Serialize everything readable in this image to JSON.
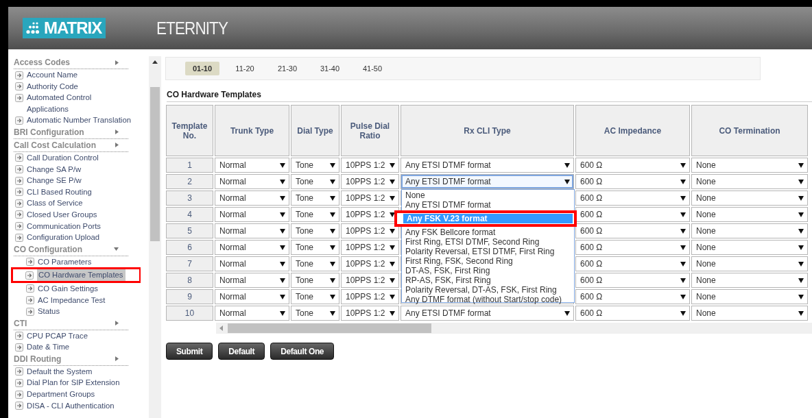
{
  "header": {
    "logo": "MATRIX",
    "product": "ETERNITY"
  },
  "sidebar": {
    "items": [
      {
        "kind": "group",
        "label": "Access Codes",
        "expanded": false
      },
      {
        "kind": "link",
        "label": "Account Name",
        "selected": false
      },
      {
        "kind": "link",
        "label": "Authority Code",
        "selected": false
      },
      {
        "kind": "link",
        "label": "Automated Control Applications",
        "selected": false
      },
      {
        "kind": "link",
        "label": "Automatic Number Translation",
        "selected": false
      },
      {
        "kind": "group",
        "label": "BRI Configuration",
        "expanded": false
      },
      {
        "kind": "group",
        "label": "Call Cost Calculation",
        "expanded": false
      },
      {
        "kind": "link",
        "label": "Call Duration Control",
        "selected": false
      },
      {
        "kind": "link",
        "label": "Change SA P/w",
        "selected": false
      },
      {
        "kind": "link",
        "label": "Change SE P/w",
        "selected": false
      },
      {
        "kind": "link",
        "label": "CLI Based Routing",
        "selected": false
      },
      {
        "kind": "link",
        "label": "Class of Service",
        "selected": false
      },
      {
        "kind": "link",
        "label": "Closed User Groups",
        "selected": false
      },
      {
        "kind": "link",
        "label": "Communication Ports",
        "selected": false
      },
      {
        "kind": "link",
        "label": "Configuration Upload",
        "selected": false
      },
      {
        "kind": "group",
        "label": "CO Configuration",
        "expanded": true,
        "children": [
          {
            "label": "CO Parameters",
            "selected": false,
            "highlighted": false
          },
          {
            "label": "CO Hardware Templates",
            "selected": true,
            "highlighted": true
          },
          {
            "label": "CO Gain Settings",
            "selected": false,
            "highlighted": false
          },
          {
            "label": "AC Impedance Test",
            "selected": false,
            "highlighted": false
          },
          {
            "label": "Status",
            "selected": false,
            "highlighted": false
          }
        ]
      },
      {
        "kind": "group",
        "label": "CTI",
        "expanded": false
      },
      {
        "kind": "link",
        "label": "CPU PCAP Trace",
        "selected": false
      },
      {
        "kind": "link",
        "label": "Date & Time",
        "selected": false
      },
      {
        "kind": "group",
        "label": "DDI Routing",
        "expanded": false
      },
      {
        "kind": "link",
        "label": "Default the System",
        "selected": false
      },
      {
        "kind": "link",
        "label": "Dial Plan for SIP Extension",
        "selected": false
      },
      {
        "kind": "link",
        "label": "Department Groups",
        "selected": false
      },
      {
        "kind": "link",
        "label": "DISA - CLI Authentication",
        "selected": false
      }
    ]
  },
  "pager": {
    "tabs": [
      {
        "label": "01-10",
        "selected": true
      },
      {
        "label": "11-20",
        "selected": false
      },
      {
        "label": "21-30",
        "selected": false
      },
      {
        "label": "31-40",
        "selected": false
      },
      {
        "label": "41-50",
        "selected": false
      }
    ]
  },
  "section_title": "CO Hardware Templates",
  "table": {
    "columns": [
      "Template No.",
      "Trunk Type",
      "Dial Type",
      "Pulse Dial Ratio",
      "Rx CLI Type",
      "AC Impedance",
      "CO Termination"
    ],
    "rows": [
      {
        "no": "1",
        "trunk": "Normal",
        "dial": "Tone",
        "pulse": "10PPS 1:2",
        "rx_cli": "Any ETSI DTMF format",
        "rx_open": false,
        "ac": "600 Ω",
        "termination": "None"
      },
      {
        "no": "2",
        "trunk": "Normal",
        "dial": "Tone",
        "pulse": "10PPS 1:2",
        "rx_cli": "Any ETSI DTMF format",
        "rx_open": true,
        "ac": "600 Ω",
        "termination": "None",
        "rx_options": [
          {
            "label": "None",
            "selected": false,
            "highlighted": false
          },
          {
            "label": "Any ETSI DTMF format",
            "selected": false,
            "highlighted": false
          },
          {
            "label": "Any FSK V.23 format",
            "selected": true,
            "highlighted": true
          },
          {
            "label": "Any FSK Bellcore format",
            "selected": false,
            "highlighted": false
          },
          {
            "label": "First Ring, ETSI DTMF, Second Ring",
            "selected": false,
            "highlighted": false
          },
          {
            "label": "Polarity Reversal, ETSI DTMF, First Ring",
            "selected": false,
            "highlighted": false
          },
          {
            "label": "First Ring, FSK, Second Ring",
            "selected": false,
            "highlighted": false
          },
          {
            "label": "DT-AS, FSK, First Ring",
            "selected": false,
            "highlighted": false
          },
          {
            "label": "RP-AS, FSK, First Ring",
            "selected": false,
            "highlighted": false
          },
          {
            "label": "Polarity Reversal, DT-AS, FSK, First Ring",
            "selected": false,
            "highlighted": false
          },
          {
            "label": "Any DTMF format (without Start/stop code)",
            "selected": false,
            "highlighted": false
          }
        ]
      },
      {
        "no": "3",
        "trunk": "Normal",
        "dial": "Tone",
        "pulse": "10PPS 1:2",
        "ac": "600 Ω",
        "termination": "None"
      },
      {
        "no": "4",
        "trunk": "Normal",
        "dial": "Tone",
        "pulse": "10PPS 1:2",
        "ac": "600 Ω",
        "termination": "None"
      },
      {
        "no": "5",
        "trunk": "Normal",
        "dial": "Tone",
        "pulse": "10PPS 1:2",
        "ac": "600 Ω",
        "termination": "None"
      },
      {
        "no": "6",
        "trunk": "Normal",
        "dial": "Tone",
        "pulse": "10PPS 1:2",
        "ac": "600 Ω",
        "termination": "None"
      },
      {
        "no": "7",
        "trunk": "Normal",
        "dial": "Tone",
        "pulse": "10PPS 1:2",
        "ac": "600 Ω",
        "termination": "None"
      },
      {
        "no": "8",
        "trunk": "Normal",
        "dial": "Tone",
        "pulse": "10PPS 1:2",
        "ac": "600 Ω",
        "termination": "None"
      },
      {
        "no": "9",
        "trunk": "Normal",
        "dial": "Tone",
        "pulse": "10PPS 1:2",
        "ac": "600 Ω",
        "termination": "None"
      },
      {
        "no": "10",
        "trunk": "Normal",
        "dial": "Tone",
        "pulse": "10PPS 1:2",
        "rx_cli": "Any ETSI DTMF format",
        "rx_open": false,
        "ac": "600 Ω",
        "termination": "None"
      }
    ]
  },
  "buttons": [
    "Submit",
    "Default",
    "Default One"
  ]
}
